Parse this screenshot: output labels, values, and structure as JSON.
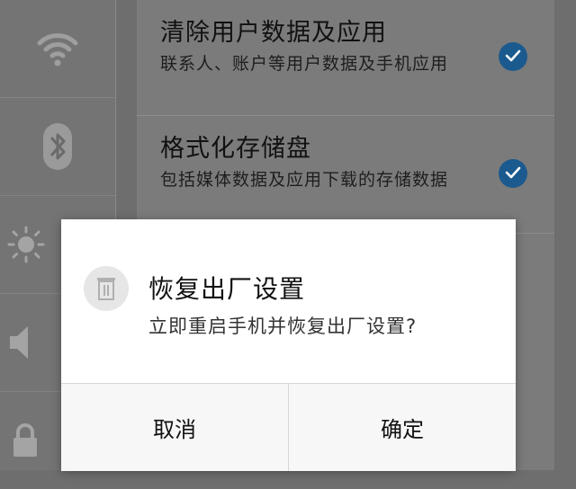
{
  "sidebar": {
    "icons": [
      "wifi-icon",
      "bluetooth-icon",
      "brightness-icon",
      "volume-icon",
      "lock-icon"
    ]
  },
  "settings_list": {
    "items": [
      {
        "title": "清除用户数据及应用",
        "subtitle": "联系人、账户等用户数据及手机应用",
        "checked": true
      },
      {
        "title": "格式化存储盘",
        "subtitle": "包括媒体数据及应用下载的存储数据",
        "checked": true
      }
    ]
  },
  "dialog": {
    "icon": "trash-icon",
    "title": "恢复出厂设置",
    "message": "立即重启手机并恢复出厂设置?",
    "cancel_label": "取消",
    "confirm_label": "确定"
  },
  "colors": {
    "accent": "#1b5a8e",
    "overlay": "#6e6e6e",
    "dialog_bg": "#ffffff"
  }
}
